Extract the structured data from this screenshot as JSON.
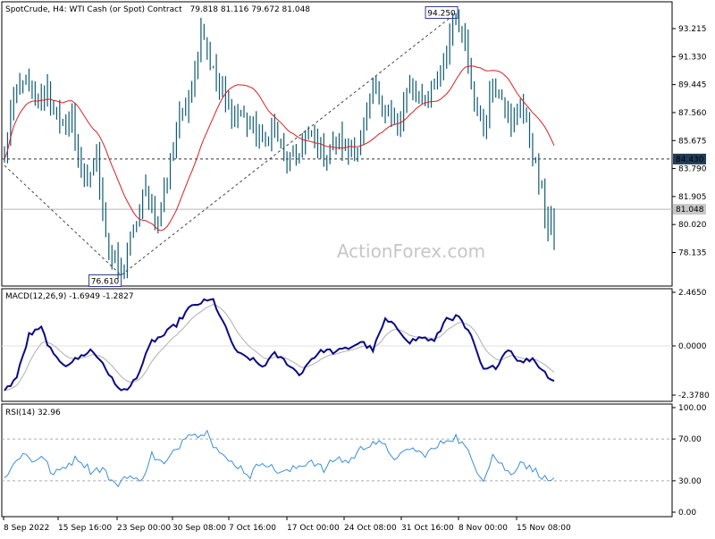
{
  "header": {
    "symbol_line": "SpotCrude, H4:  WTI Cash (or Spot) Contract",
    "ohlc": "79.818 81.116 79.672 81.048"
  },
  "watermark": "ActionForex.com",
  "chart_data": [
    {
      "type": "candlestick",
      "title": "SpotCrude, H4:  WTI Cash (or Spot) Contract",
      "last_ohlc": [
        79.818,
        81.116,
        79.672,
        81.048
      ],
      "ylim": [
        76.61,
        95.0
      ],
      "y_ticks": [
        "93.215",
        "91.330",
        "89.445",
        "87.560",
        "85.675",
        "83.790",
        "81.905",
        "80.020",
        "78.135"
      ],
      "x_ticks": [
        "8 Sep 2022",
        "15 Sep 16:00",
        "23 Sep 00:00",
        "30 Sep 08:00",
        "7 Oct 16:00",
        "17 Oct 00:00",
        "24 Oct 08:00",
        "31 Oct 16:00",
        "8 Nov 00:00",
        "15 Nov 08:00"
      ],
      "price_labels": {
        "low": "76.610",
        "high": "94.250",
        "level": "84.430",
        "last": "81.048"
      },
      "level_line": 84.43,
      "bar_color": "#0f5a74",
      "ma_color": "#d92020",
      "anchors": [
        [
          0,
          84.2
        ],
        [
          2,
          87.5
        ],
        [
          6,
          90.0
        ],
        [
          10,
          88.2
        ],
        [
          14,
          89.2
        ],
        [
          18,
          86.5
        ],
        [
          22,
          87.0
        ],
        [
          26,
          82.5
        ],
        [
          30,
          84.4
        ],
        [
          34,
          78.0
        ],
        [
          38,
          76.8
        ],
        [
          42,
          79.5
        ],
        [
          46,
          82.3
        ],
        [
          50,
          80.2
        ],
        [
          54,
          84.5
        ],
        [
          58,
          87.8
        ],
        [
          62,
          90.2
        ],
        [
          64,
          93.6
        ],
        [
          66,
          92.0
        ],
        [
          68,
          90.2
        ],
        [
          72,
          88.3
        ],
        [
          76,
          87.4
        ],
        [
          80,
          87.0
        ],
        [
          84,
          85.5
        ],
        [
          88,
          86.5
        ],
        [
          92,
          84.0
        ],
        [
          96,
          85.0
        ],
        [
          100,
          86.0
        ],
        [
          104,
          84.5
        ],
        [
          108,
          85.8
        ],
        [
          112,
          85.0
        ],
        [
          116,
          85.5
        ],
        [
          120,
          89.0
        ],
        [
          124,
          88.0
        ],
        [
          128,
          86.5
        ],
        [
          132,
          89.2
        ],
        [
          136,
          88.5
        ],
        [
          140,
          89.5
        ],
        [
          144,
          92.0
        ],
        [
          147,
          94.0
        ],
        [
          150,
          92.0
        ],
        [
          153,
          88.5
        ],
        [
          156,
          86.5
        ],
        [
          159,
          90.0
        ],
        [
          162,
          89.0
        ],
        [
          165,
          86.0
        ],
        [
          168,
          88.5
        ],
        [
          171,
          86.0
        ],
        [
          174,
          83.0
        ],
        [
          177,
          79.8
        ],
        [
          179,
          81.0
        ]
      ]
    },
    {
      "type": "line",
      "title": "MACD(12,26,9) -1.6949 -1.2827",
      "series": [
        {
          "name": "MACD",
          "color": "#0b0b82"
        },
        {
          "name": "Signal",
          "color": "#b0b0b0"
        }
      ],
      "ylim": [
        -2.378,
        2.465
      ],
      "y_ticks": [
        "2.4650",
        "0.0000",
        "-2.3780"
      ],
      "anchors": [
        [
          0,
          -2.2
        ],
        [
          4,
          -1.5
        ],
        [
          8,
          0.5
        ],
        [
          12,
          0.8
        ],
        [
          16,
          -0.5
        ],
        [
          20,
          -0.9
        ],
        [
          24,
          -0.6
        ],
        [
          28,
          -0.2
        ],
        [
          32,
          -0.8
        ],
        [
          36,
          -1.9
        ],
        [
          40,
          -2.2
        ],
        [
          44,
          -1.2
        ],
        [
          48,
          0.2
        ],
        [
          52,
          0.5
        ],
        [
          56,
          1.0
        ],
        [
          60,
          1.7
        ],
        [
          64,
          2.0
        ],
        [
          68,
          2.1
        ],
        [
          72,
          0.8
        ],
        [
          76,
          -0.4
        ],
        [
          80,
          -0.6
        ],
        [
          84,
          -1.0
        ],
        [
          88,
          -0.4
        ],
        [
          92,
          -0.8
        ],
        [
          96,
          -1.4
        ],
        [
          100,
          -0.6
        ],
        [
          104,
          -0.2
        ],
        [
          108,
          -0.3
        ],
        [
          112,
          -0.1
        ],
        [
          116,
          0.2
        ],
        [
          120,
          -0.2
        ],
        [
          124,
          1.2
        ],
        [
          128,
          0.8
        ],
        [
          132,
          0.2
        ],
        [
          136,
          0.4
        ],
        [
          140,
          0.2
        ],
        [
          144,
          1.3
        ],
        [
          148,
          1.3
        ],
        [
          152,
          0.4
        ],
        [
          156,
          -1.2
        ],
        [
          160,
          -1.0
        ],
        [
          164,
          -0.1
        ],
        [
          168,
          -0.8
        ],
        [
          172,
          -0.6
        ],
        [
          176,
          -1.3
        ],
        [
          179,
          -1.69
        ]
      ]
    },
    {
      "type": "line",
      "title": "RSI(14) 32.96",
      "series": [
        {
          "name": "RSI",
          "color": "#3a8ed8"
        }
      ],
      "ylim": [
        0,
        100
      ],
      "y_ticks": [
        "100.00",
        "70.00",
        "30.00",
        "0.00"
      ],
      "levels": [
        70,
        30
      ],
      "last": 32.96,
      "anchors": [
        [
          0,
          33
        ],
        [
          3,
          45
        ],
        [
          6,
          58
        ],
        [
          9,
          48
        ],
        [
          12,
          55
        ],
        [
          16,
          35
        ],
        [
          20,
          45
        ],
        [
          24,
          52
        ],
        [
          28,
          40
        ],
        [
          32,
          42
        ],
        [
          36,
          25
        ],
        [
          40,
          36
        ],
        [
          44,
          28
        ],
        [
          48,
          55
        ],
        [
          52,
          45
        ],
        [
          56,
          60
        ],
        [
          60,
          78
        ],
        [
          64,
          72
        ],
        [
          66,
          82
        ],
        [
          68,
          65
        ],
        [
          72,
          50
        ],
        [
          76,
          45
        ],
        [
          80,
          35
        ],
        [
          84,
          50
        ],
        [
          88,
          40
        ],
        [
          92,
          38
        ],
        [
          96,
          44
        ],
        [
          100,
          50
        ],
        [
          104,
          40
        ],
        [
          108,
          52
        ],
        [
          112,
          48
        ],
        [
          116,
          60
        ],
        [
          120,
          68
        ],
        [
          124,
          62
        ],
        [
          128,
          50
        ],
        [
          132,
          62
        ],
        [
          136,
          55
        ],
        [
          140,
          60
        ],
        [
          144,
          70
        ],
        [
          147,
          72
        ],
        [
          150,
          62
        ],
        [
          153,
          45
        ],
        [
          156,
          32
        ],
        [
          159,
          55
        ],
        [
          162,
          45
        ],
        [
          165,
          35
        ],
        [
          168,
          50
        ],
        [
          171,
          42
        ],
        [
          174,
          38
        ],
        [
          177,
          29
        ],
        [
          179,
          32.96
        ]
      ]
    }
  ]
}
